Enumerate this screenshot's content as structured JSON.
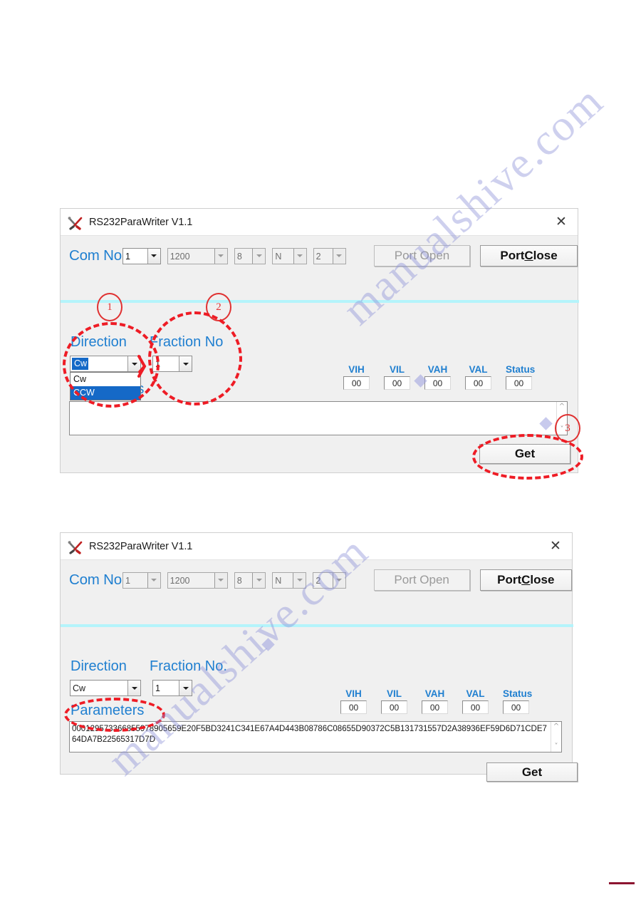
{
  "app": {
    "title": "RS232ParaWriter V1.1",
    "icon": "tools-icon",
    "close_label": "✕"
  },
  "toolbar": {
    "com_label": "Com No",
    "port_value": "1",
    "baud_value": "1200",
    "databits_value": "8",
    "parity_value": "N",
    "stopbits_value": "2",
    "port_open_label": "Port Open",
    "port_close_label": "Port Close",
    "port_close_prefix": "Port ",
    "port_close_accel": "C",
    "port_close_suffix": "lose"
  },
  "form": {
    "direction_label": "Direction",
    "fraction_label": "Fraction No.",
    "fraction_label_short": "Fraction No",
    "parameters_label": "Parameters",
    "direction_value": "Cw",
    "direction_options": [
      "Cw",
      "CCW"
    ],
    "direction_selected_option": "CCW",
    "fraction_value": "1",
    "get_label": "Get"
  },
  "readouts": {
    "labels": [
      "VIH",
      "VIL",
      "VAH",
      "VAL",
      "Status"
    ],
    "values": [
      "00",
      "00",
      "00",
      "00",
      "00"
    ]
  },
  "window_one": {
    "parameters_text": ""
  },
  "window_two": {
    "parameters_text": "000129573366855978905659E20F5BD3241C341E67A4D443B08786C08655D90372C5B131731557D2A38936EF59D6D71CDE764DA7B22565317D7D"
  },
  "annotations": {
    "marker_one": "1",
    "marker_two": "2",
    "marker_three": "3"
  },
  "watermark": {
    "line_one": "manualshive.com",
    "line_two": "manualshive.com"
  },
  "colors": {
    "label_blue": "#1f7fd0",
    "annotation_red": "#ee1c25",
    "cyan_rule": "#b4f4fb",
    "highlight_blue": "#1569c7"
  }
}
